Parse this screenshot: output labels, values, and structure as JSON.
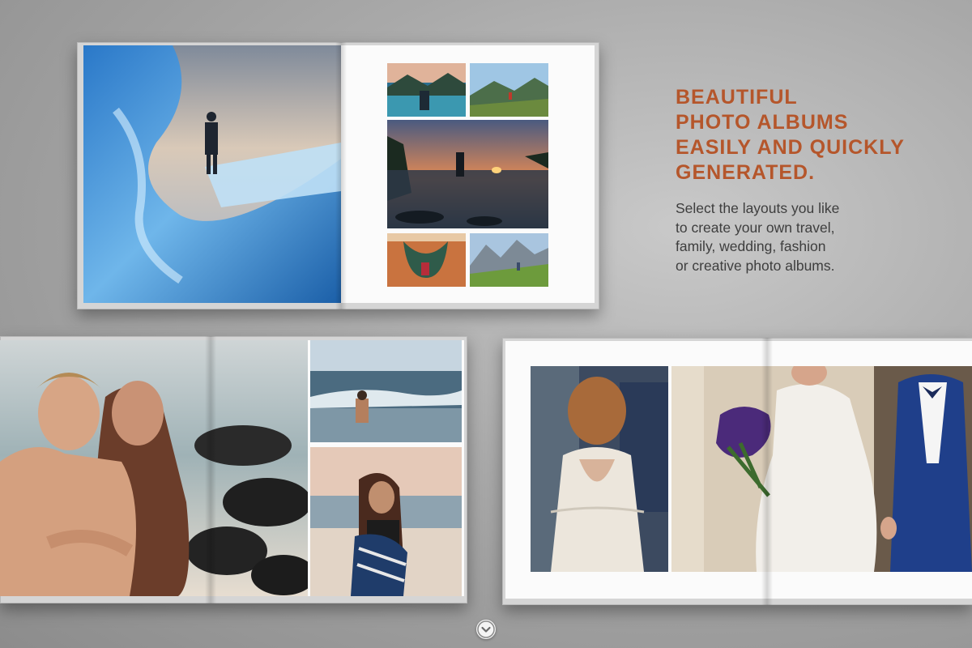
{
  "promo": {
    "headline_lines": [
      "BEAUTIFUL",
      "PHOTO ALBUMS",
      "EASILY AND QUICKLY",
      "GENERATED."
    ],
    "body_lines": [
      "Select the layouts you like",
      "to create your own travel,",
      "family, wedding, fashion",
      "or creative photo albums."
    ]
  },
  "colors": {
    "headline": "#b5562b",
    "body_text": "#3e3e3e",
    "background": "#a9a9a9"
  },
  "albums": [
    {
      "name": "travel-album",
      "photos": [
        "ice-cave-explorer-photo",
        "lake-mountains-photo",
        "mountain-overlook-photo",
        "sunset-coast-photo",
        "canyon-bend-photo",
        "alpine-meadow-photo"
      ]
    },
    {
      "name": "fashion-album",
      "photos": [
        "beach-couple-photo",
        "ocean-wave-photo",
        "woman-with-towel-photo"
      ]
    },
    {
      "name": "wedding-album",
      "photos": [
        "bride-back-photo",
        "wedding-couple-photo"
      ]
    }
  ],
  "scroll_down": {
    "icon": "chevron-down-icon"
  }
}
